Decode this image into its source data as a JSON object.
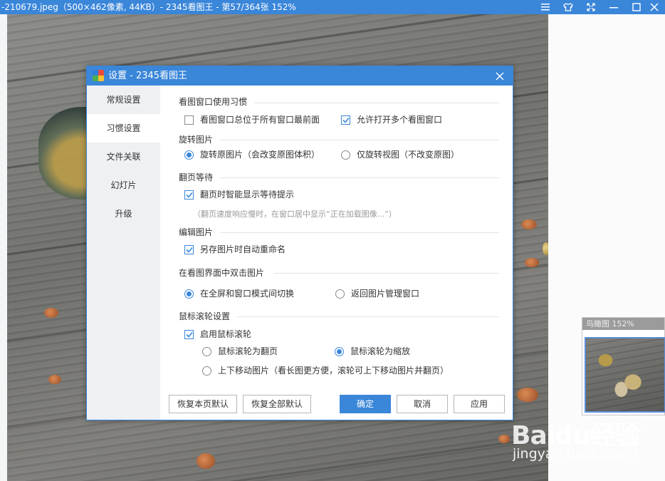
{
  "window": {
    "title": "-210679.jpeg（500×462像素, 44KB）- 2345看图王 - 第57/364张 152%",
    "controls": [
      "menu-icon",
      "skin-icon",
      "fullscreen-icon",
      "minimize-icon",
      "maximize-icon",
      "close-icon"
    ]
  },
  "birdseye": {
    "title": "鸟瞰图 152%"
  },
  "watermark": {
    "main": "Baidu经验",
    "sub": "jingyan.baidu.com"
  },
  "dialog": {
    "title": "设置 - 2345看图王",
    "nav": [
      {
        "label": "常规设置",
        "active": false
      },
      {
        "label": "习惯设置",
        "active": true
      },
      {
        "label": "文件关联",
        "active": false
      },
      {
        "label": "幻灯片",
        "active": false
      },
      {
        "label": "升级",
        "active": false
      }
    ],
    "sections": {
      "habit": {
        "title": "看图窗口使用习惯",
        "always_on_top": {
          "label": "看图窗口总位于所有窗口最前面",
          "checked": false
        },
        "multi_window": {
          "label": "允许打开多个看图窗口",
          "checked": true
        }
      },
      "rotate": {
        "title": "旋转图片",
        "rotate_original": {
          "label": "旋转原图片（会改变原图体积）",
          "selected": true
        },
        "rotate_view": {
          "label": "仅旋转视图（不改变原图）",
          "selected": false
        }
      },
      "page_wait": {
        "title": "翻页等待",
        "smart_hint": {
          "label": "翻页时智能显示等待提示",
          "checked": true
        },
        "hint": "（翻页速度响应慢时，在窗口居中显示“正在加载图像...”）"
      },
      "edit": {
        "title": "编辑图片",
        "auto_rename": {
          "label": "另存图片时自动重命名",
          "checked": true
        }
      },
      "double_click": {
        "title": "在看图界面中双击图片",
        "toggle_fullscreen": {
          "label": "在全屏和窗口模式间切换",
          "selected": true
        },
        "return_manager": {
          "label": "返回图片管理窗口",
          "selected": false
        }
      },
      "wheel": {
        "title": "鼠标滚轮设置",
        "enable": {
          "label": "启用鼠标滚轮",
          "checked": true
        },
        "page": {
          "label": "鼠标滚轮为翻页",
          "selected": false
        },
        "zoom": {
          "label": "鼠标滚轮为缩放",
          "selected": true
        },
        "move": {
          "label": "上下移动图片（看长图更方便，滚轮可上下移动图片并翻页）",
          "selected": false
        }
      }
    },
    "buttons": {
      "reset_page": "恢复本页默认",
      "reset_all": "恢复全部默认",
      "ok": "确定",
      "cancel": "取消",
      "apply": "应用"
    }
  },
  "colors": {
    "accent": "#3a86d9",
    "nav_bg": "#eef0f3"
  }
}
